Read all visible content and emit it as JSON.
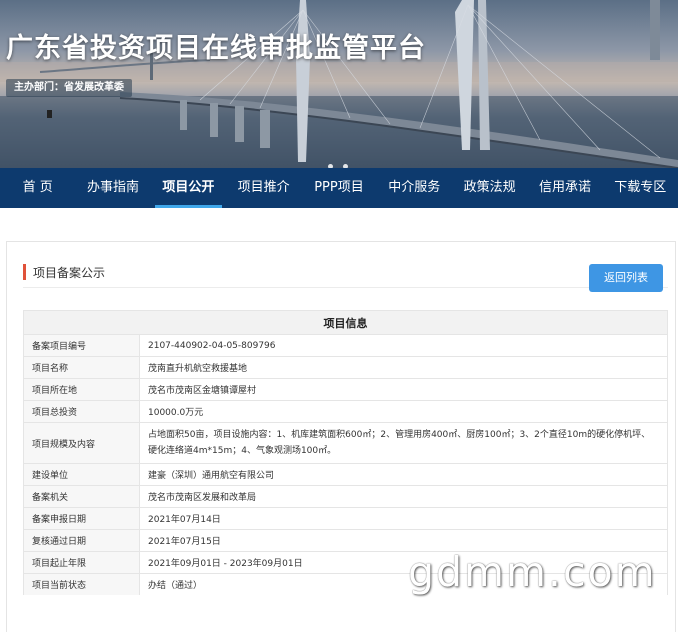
{
  "header": {
    "title": "广东省投资项目在线审批监管平台",
    "subtitle": "主办部门：省发展改革委",
    "slider_dots": 2
  },
  "nav": {
    "items": [
      {
        "label": "首 页",
        "active": false
      },
      {
        "label": "办事指南",
        "active": false
      },
      {
        "label": "项目公开",
        "active": true
      },
      {
        "label": "项目推介",
        "active": false
      },
      {
        "label": "PPP项目",
        "active": false
      },
      {
        "label": "中介服务",
        "active": false
      },
      {
        "label": "政策法规",
        "active": false
      },
      {
        "label": "信用承诺",
        "active": false
      },
      {
        "label": "下载专区",
        "active": false
      }
    ]
  },
  "section": {
    "title": "项目备案公示",
    "back_label": "返回列表"
  },
  "table": {
    "header": "项目信息",
    "rows": [
      {
        "label": "备案项目编号",
        "value": "2107-440902-04-05-809796"
      },
      {
        "label": "项目名称",
        "value": "茂南直升机航空救援基地"
      },
      {
        "label": "项目所在地",
        "value": "茂名市茂南区金塘镇谭屋村"
      },
      {
        "label": "项目总投资",
        "value": "10000.0万元"
      },
      {
        "label": "项目规模及内容",
        "value": "占地面积50亩，项目设施内容：1、机库建筑面积600㎡；2、管理用房400㎡、厨房100㎡；3、2个直径10m的硬化停机坪、硬化连络道4m*15m；4、气象观测场100㎡。"
      },
      {
        "label": "建设单位",
        "value": "建豪（深圳）通用航空有限公司"
      },
      {
        "label": "备案机关",
        "value": "茂名市茂南区发展和改革局"
      },
      {
        "label": "备案申报日期",
        "value": "2021年07月14日"
      },
      {
        "label": "复核通过日期",
        "value": "2021年07月15日"
      },
      {
        "label": "项目起止年限",
        "value": "2021年09月01日 - 2023年09月01日"
      },
      {
        "label": "项目当前状态",
        "value": "办结（通过）"
      }
    ]
  },
  "watermark": "gdmm.com"
}
